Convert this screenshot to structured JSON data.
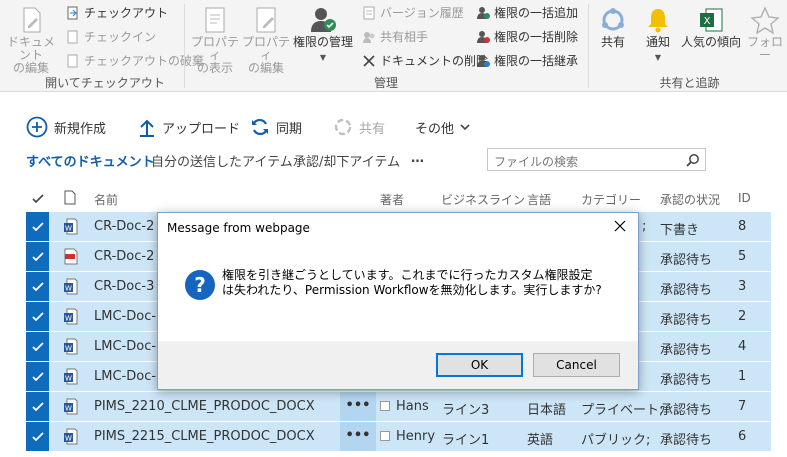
{
  "ribbon": {
    "open_and_checkout": {
      "edit_document": "ドキュメント\nの編集",
      "checkout": "チェックアウト",
      "checkin": "チェックイン",
      "discard_checkout": "チェックアウトの破棄",
      "label": "開いてチェックアウト"
    },
    "manage": {
      "view_properties": "プロパティ\nの表示",
      "edit_properties": "プロパティ\nの編集",
      "permissions": "権限の管理",
      "version_history": "バージョン履歴",
      "shared_with": "共有相手",
      "delete_document": "ドキュメントの削除",
      "bulk_add": "権限の一括追加",
      "bulk_delete": "権限の一括削除",
      "bulk_inherit": "権限の一括継承",
      "label": "管理"
    },
    "share_track": {
      "share": "共有",
      "alert": "通知",
      "popularity": "人気の傾向",
      "follow": "フォロー",
      "label": "共有と追跡"
    }
  },
  "commands": {
    "new": "新規作成",
    "upload": "アップロード",
    "sync": "同期",
    "share": "共有",
    "more": "その他"
  },
  "views": {
    "all_documents": "すべてのドキュメント",
    "my_submissions": "自分の送信したアイテム",
    "approve_reject": "承認/却下アイテム",
    "ellipsis": "…"
  },
  "search": {
    "placeholder": "ファイルの検索"
  },
  "table": {
    "headers": {
      "name": "名前",
      "author": "著者",
      "business_line": "ビジネスライン",
      "language": "言語",
      "category": "カテゴリー",
      "approval": "承認の状況",
      "id": "ID"
    },
    "rows": [
      {
        "name": "CR-Doc-2",
        "file_type": "word",
        "approval": "下書き",
        "id": "8",
        "author": "",
        "line": "",
        "lang": "",
        "category": ""
      },
      {
        "name": "CR-Doc-2",
        "file_type": "pdf",
        "approval": "承認待ち",
        "id": "5",
        "author": "",
        "line": "",
        "lang": "",
        "category": ""
      },
      {
        "name": "CR-Doc-3",
        "file_type": "word",
        "approval": "承認待ち",
        "id": "3",
        "author": "",
        "line": "",
        "lang": "",
        "category": ""
      },
      {
        "name": "LMC-Doc-",
        "file_type": "word",
        "approval": "承認待ち",
        "id": "2",
        "author": "",
        "line": "",
        "lang": "",
        "category": ""
      },
      {
        "name": "LMC-Doc-",
        "file_type": "word",
        "approval": "承認待ち",
        "id": "4",
        "author": "",
        "line": "",
        "lang": "",
        "category": ""
      },
      {
        "name": "LMC-Doc-",
        "file_type": "word",
        "approval": "承認待ち",
        "id": "1",
        "author": "",
        "line": "",
        "lang": "",
        "category": ""
      },
      {
        "name": "PIMS_2210_CLME_PRODOC_DOCX",
        "file_type": "word",
        "approval": "承認待ち",
        "id": "7",
        "author": "Hans",
        "line": "ライン3",
        "lang": "日本語",
        "category": "プライベート;"
      },
      {
        "name": "PIMS_2215_CLME_PRODOC_DOCX",
        "file_type": "word",
        "approval": "承認待ち",
        "id": "6",
        "author": "Henry",
        "line": "ライン1",
        "lang": "英語",
        "category": "パブリック;"
      }
    ],
    "row_overflow_marker": "…",
    "dots": "•••"
  },
  "dialog": {
    "title": "Message from webpage",
    "message": "権限を引き継ごうとしています。これまでに行ったカスタム権限設定は失われたり、Permission Workflowを無効化します。実行しますか?",
    "ok": "OK",
    "cancel": "Cancel",
    "partial_category": ";"
  },
  "colors": {
    "accent": "#0f6cbd",
    "row_selected": "#cde6f7",
    "view_active": "#0f5dab"
  }
}
